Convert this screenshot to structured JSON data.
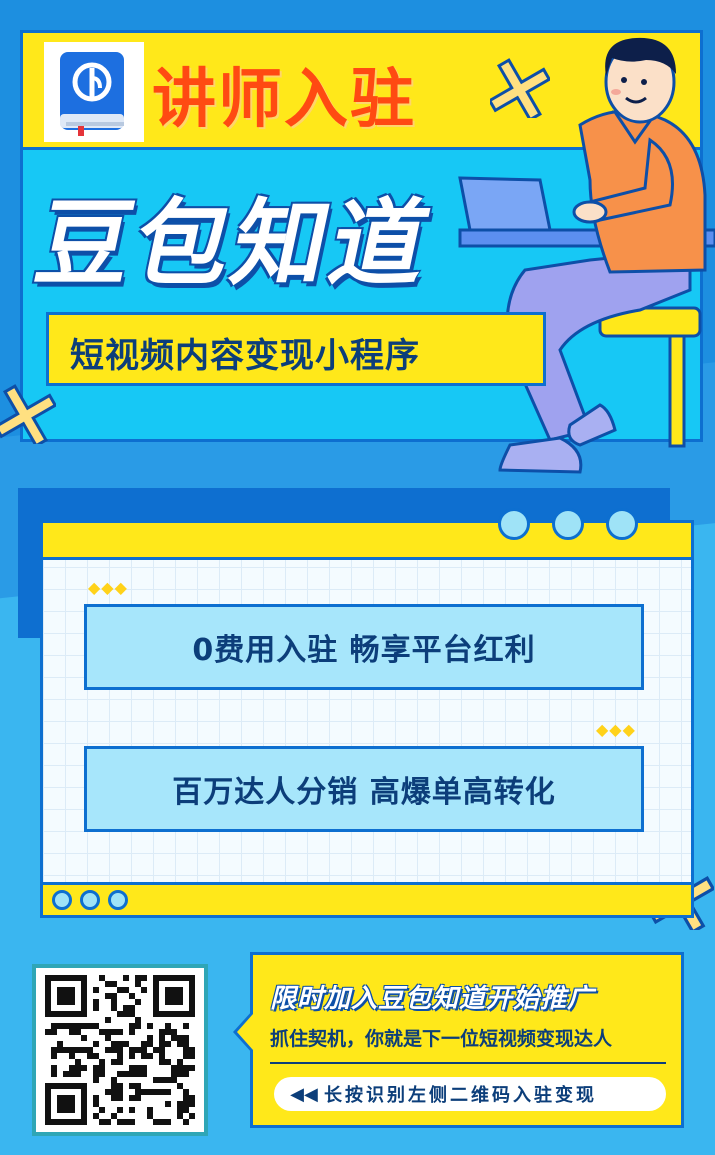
{
  "header": {
    "title": "讲师入驻",
    "brand": "豆包知道",
    "subtitle": "短视频内容变现小程序"
  },
  "benefits": [
    {
      "text": "0费用入驻  畅享平台红利"
    },
    {
      "text": "百万达人分销  高爆单高转化"
    }
  ],
  "promo": {
    "title": "限时加入豆包知道开始推广",
    "subtitle": "抓住契机，你就是下一位短视频变现达人",
    "cta": "长按识别左侧二维码入驻变现"
  },
  "icons": {
    "logo": "book-logo-icon",
    "cta": "double-arrow-left-icon",
    "qr": "qr-code-icon"
  },
  "colors": {
    "accent_yellow": "#ffe81a",
    "title_orange": "#ff4a12",
    "deep_blue": "#0d6fd0",
    "sky_blue": "#17c8f5"
  }
}
